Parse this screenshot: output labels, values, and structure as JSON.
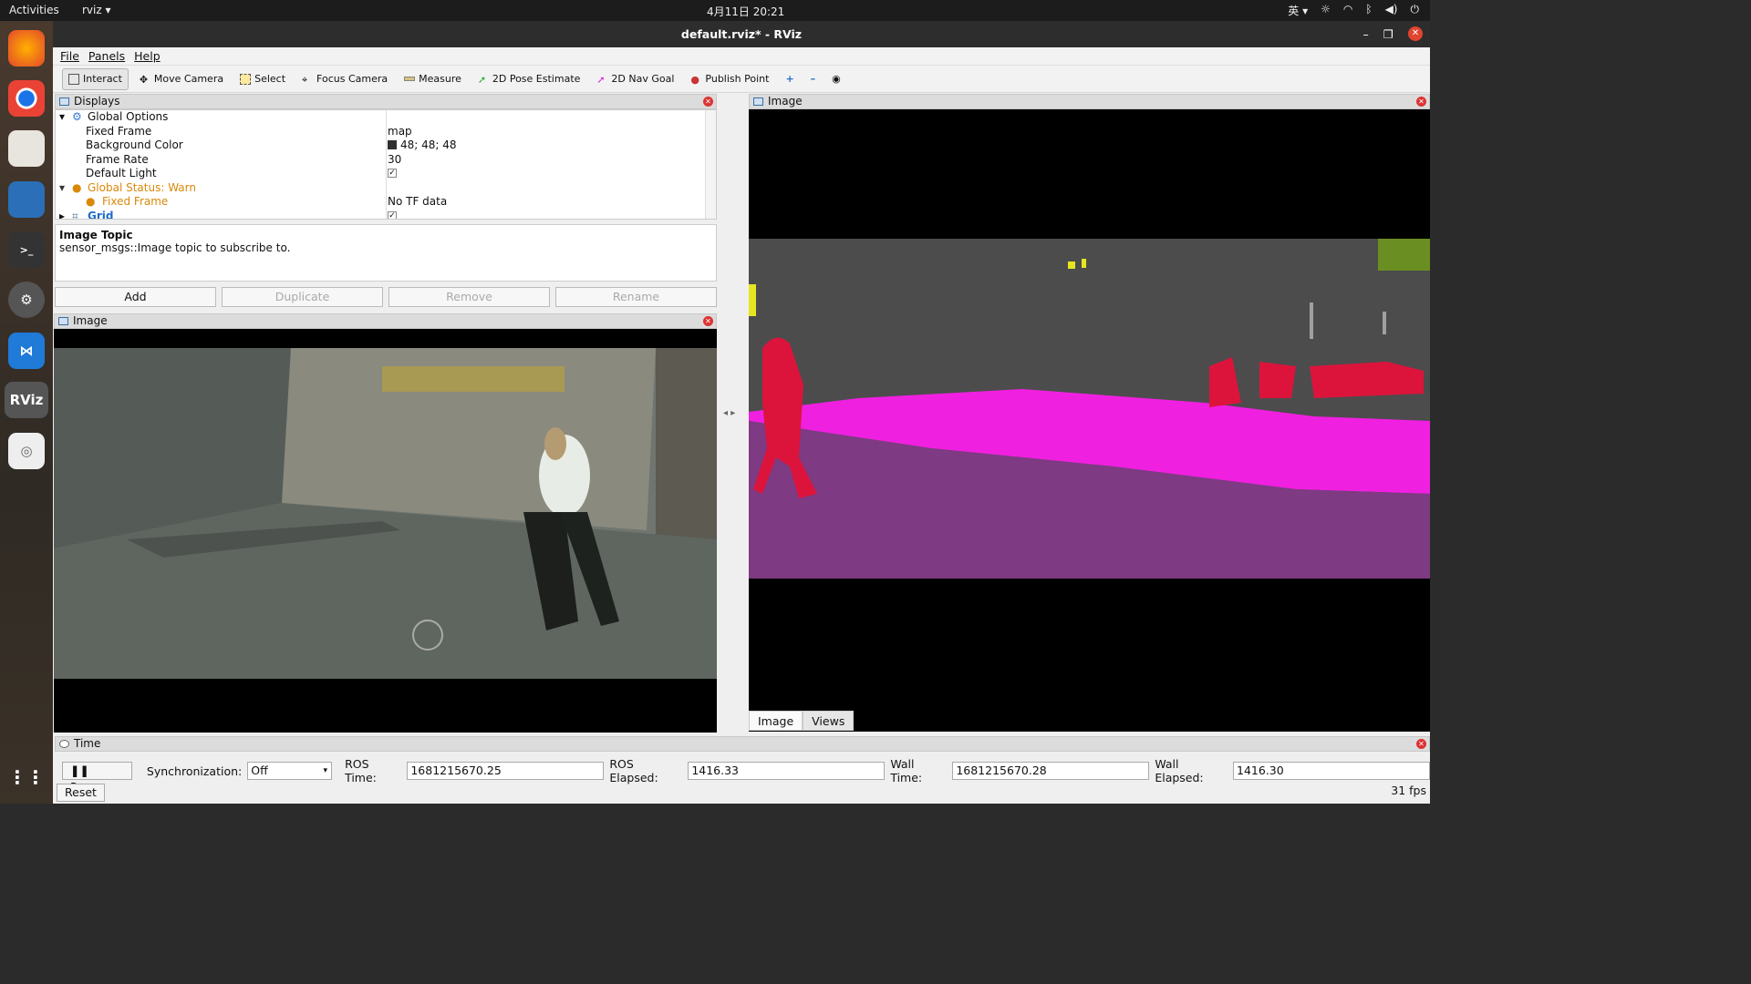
{
  "topbar": {
    "activities": "Activities",
    "app": "rviz ▾",
    "clock": "4月11日  20:21",
    "ime": "英 ▾"
  },
  "window": {
    "title": "default.rviz* - RViz"
  },
  "menu": {
    "file": "File",
    "panels": "Panels",
    "help": "Help"
  },
  "toolbar": {
    "interact": "Interact",
    "move_camera": "Move Camera",
    "select": "Select",
    "focus_camera": "Focus Camera",
    "measure": "Measure",
    "pose_estimate": "2D Pose Estimate",
    "nav_goal": "2D Nav Goal",
    "publish_point": "Publish Point"
  },
  "displays": {
    "title": "Displays",
    "global_options": "Global Options",
    "fixed_frame_label": "Fixed Frame",
    "fixed_frame_value": "map",
    "bg_color_label": "Background Color",
    "bg_color_value": "48; 48; 48",
    "frame_rate_label": "Frame Rate",
    "frame_rate_value": "30",
    "default_light_label": "Default Light",
    "global_status": "Global Status: Warn",
    "status_fixed_frame": "Fixed Frame",
    "status_fixed_frame_value": "No TF data",
    "grid": "Grid"
  },
  "description": {
    "title": "Image Topic",
    "text": "sensor_msgs::Image topic to subscribe to."
  },
  "buttons": {
    "add": "Add",
    "duplicate": "Duplicate",
    "remove": "Remove",
    "rename": "Rename"
  },
  "left_image": {
    "title": "Image"
  },
  "right_image": {
    "title": "Image",
    "tab_image": "Image",
    "tab_views": "Views"
  },
  "time": {
    "title": "Time",
    "pause": "Pause",
    "sync_label": "Synchronization:",
    "sync_value": "Off",
    "ros_time_label": "ROS Time:",
    "ros_time": "1681215670.25",
    "ros_elapsed_label": "ROS Elapsed:",
    "ros_elapsed": "1416.33",
    "wall_time_label": "Wall Time:",
    "wall_time": "1681215670.28",
    "wall_elapsed_label": "Wall Elapsed:",
    "wall_elapsed": "1416.30",
    "reset": "Reset",
    "fps": "31 fps"
  },
  "colors": {
    "road": "#f020e0",
    "sidewalk": "#7e3a82",
    "person": "#dc143c",
    "background_swatch": "#303030"
  }
}
